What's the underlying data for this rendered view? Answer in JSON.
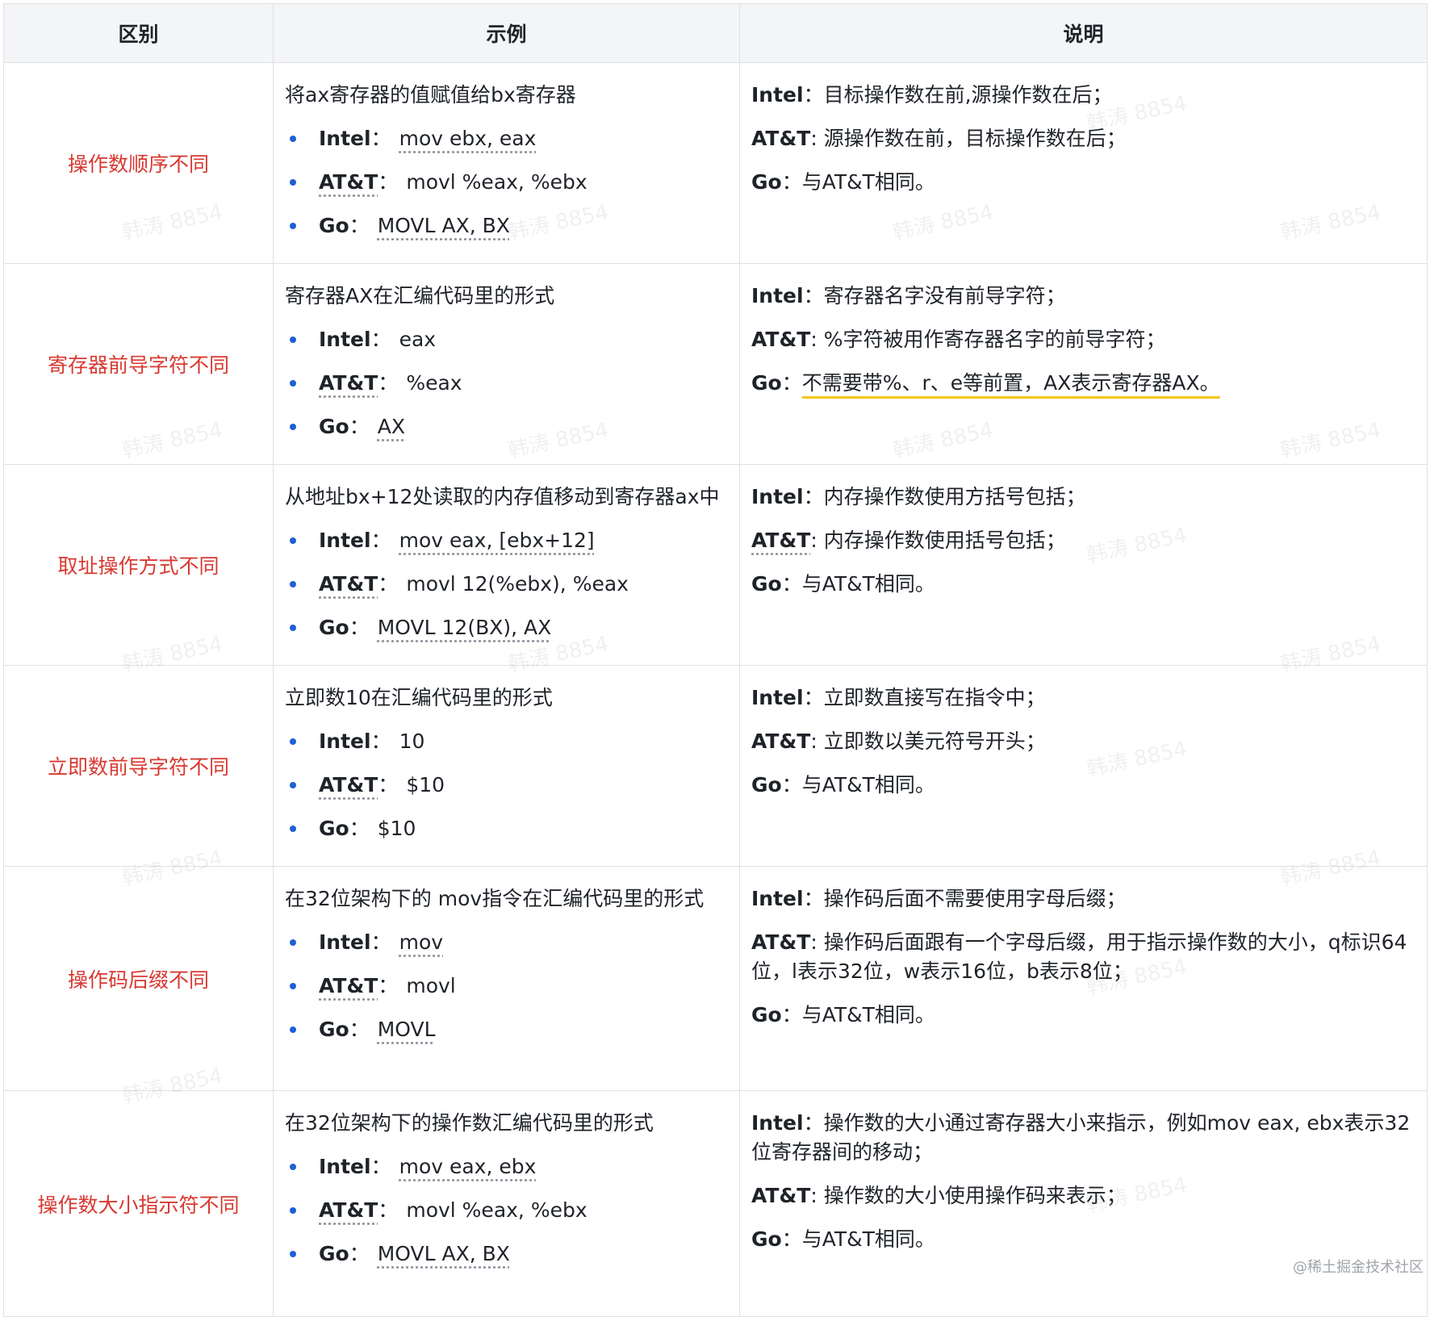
{
  "headers": [
    "区别",
    "示例",
    "说明"
  ],
  "watermark_text": "韩涛 8854",
  "credit": "@稀土掘金技术社区",
  "rows": [
    {
      "difference": "操作数顺序不同",
      "example_title": "将ax寄存器的值赋值给bx寄存器",
      "examples": [
        {
          "key": "Intel",
          "sep": "：",
          "value": "mov ebx, eax"
        },
        {
          "key": "AT&T",
          "sep": "：",
          "value": "movl %eax, %ebx"
        },
        {
          "key": "Go",
          "sep": "：",
          "value": "MOVL AX, BX"
        }
      ],
      "descriptions": [
        {
          "key": "Intel",
          "sep": "：",
          "text": "目标操作数在前,源操作数在后；"
        },
        {
          "key": "AT&T",
          "sep": ": ",
          "text": "源操作数在前，目标操作数在后；"
        },
        {
          "key": "Go",
          "sep": "：",
          "text": "与AT&T相同。"
        }
      ]
    },
    {
      "difference": "寄存器前导字符不同",
      "example_title": "寄存器AX在汇编代码里的形式",
      "examples": [
        {
          "key": "Intel",
          "sep": "：",
          "value": "eax"
        },
        {
          "key": "AT&T",
          "sep": "：",
          "value": "%eax"
        },
        {
          "key": "Go",
          "sep": "：",
          "value": "AX"
        }
      ],
      "descriptions": [
        {
          "key": "Intel",
          "sep": "：",
          "text": "寄存器名字没有前导字符；"
        },
        {
          "key": "AT&T",
          "sep": ": ",
          "text": "%字符被用作寄存器名字的前导字符；"
        },
        {
          "key": "Go",
          "sep": "：",
          "text": "不需要带%、r、e等前置，AX表示寄存器AX。"
        }
      ]
    },
    {
      "difference": "取址操作方式不同",
      "example_title": "从地址bx+12处读取的内存值移动到寄存器ax中",
      "examples": [
        {
          "key": "Intel",
          "sep": "：",
          "value": "mov eax, [ebx+12]"
        },
        {
          "key": "AT&T",
          "sep": "：",
          "value": "movl 12(%ebx), %eax"
        },
        {
          "key": "Go",
          "sep": "：",
          "value": "MOVL 12(BX), AX"
        }
      ],
      "descriptions": [
        {
          "key": "Intel",
          "sep": "：",
          "text": "内存操作数使用方括号包括；"
        },
        {
          "key": "AT&T",
          "sep": ": ",
          "text": "内存操作数使用括号包括；"
        },
        {
          "key": "Go",
          "sep": "：",
          "text": "与AT&T相同。"
        }
      ]
    },
    {
      "difference": "立即数前导字符不同",
      "example_title": "立即数10在汇编代码里的形式",
      "examples": [
        {
          "key": "Intel",
          "sep": "：",
          "value": "10"
        },
        {
          "key": "AT&T",
          "sep": "：",
          "value": "$10"
        },
        {
          "key": "Go",
          "sep": "：",
          "value": "$10"
        }
      ],
      "descriptions": [
        {
          "key": "Intel",
          "sep": "：",
          "text": "立即数直接写在指令中；"
        },
        {
          "key": "AT&T",
          "sep": ": ",
          "text": "立即数以美元符号开头；"
        },
        {
          "key": "Go",
          "sep": "：",
          "text": "与AT&T相同。"
        }
      ]
    },
    {
      "difference": "操作码后缀不同",
      "example_title": "在32位架构下的 mov指令在汇编代码里的形式",
      "examples": [
        {
          "key": "Intel",
          "sep": "：",
          "value": "mov"
        },
        {
          "key": "AT&T",
          "sep": "：",
          "value": "movl"
        },
        {
          "key": "Go",
          "sep": "：",
          "value": "MOVL"
        }
      ],
      "descriptions": [
        {
          "key": "Intel",
          "sep": "：",
          "text": "操作码后面不需要使用字母后缀；"
        },
        {
          "key": "AT&T",
          "sep": ": ",
          "text": "操作码后面跟有一个字母后缀，用于指示操作数的大小，q标识64位，l表示32位，w表示16位，b表示8位；"
        },
        {
          "key": "Go",
          "sep": "：",
          "text": "与AT&T相同。"
        }
      ]
    },
    {
      "difference": "操作数大小指示符不同",
      "example_title": "在32位架构下的操作数汇编代码里的形式",
      "examples": [
        {
          "key": "Intel",
          "sep": "：",
          "value": "mov eax, ebx"
        },
        {
          "key": "AT&T",
          "sep": "：",
          "value": "movl %eax, %ebx"
        },
        {
          "key": "Go",
          "sep": "：",
          "value": "MOVL AX, BX"
        }
      ],
      "descriptions": [
        {
          "key": "Intel",
          "sep": "：",
          "text": "操作数的大小通过寄存器大小来指示，例如mov eax, ebx表示32位寄存器间的移动；"
        },
        {
          "key": "AT&T",
          "sep": ": ",
          "text": "操作数的大小使用操作码来表示；"
        },
        {
          "key": "Go",
          "sep": "：",
          "text": "与AT&T相同。"
        }
      ]
    }
  ]
}
